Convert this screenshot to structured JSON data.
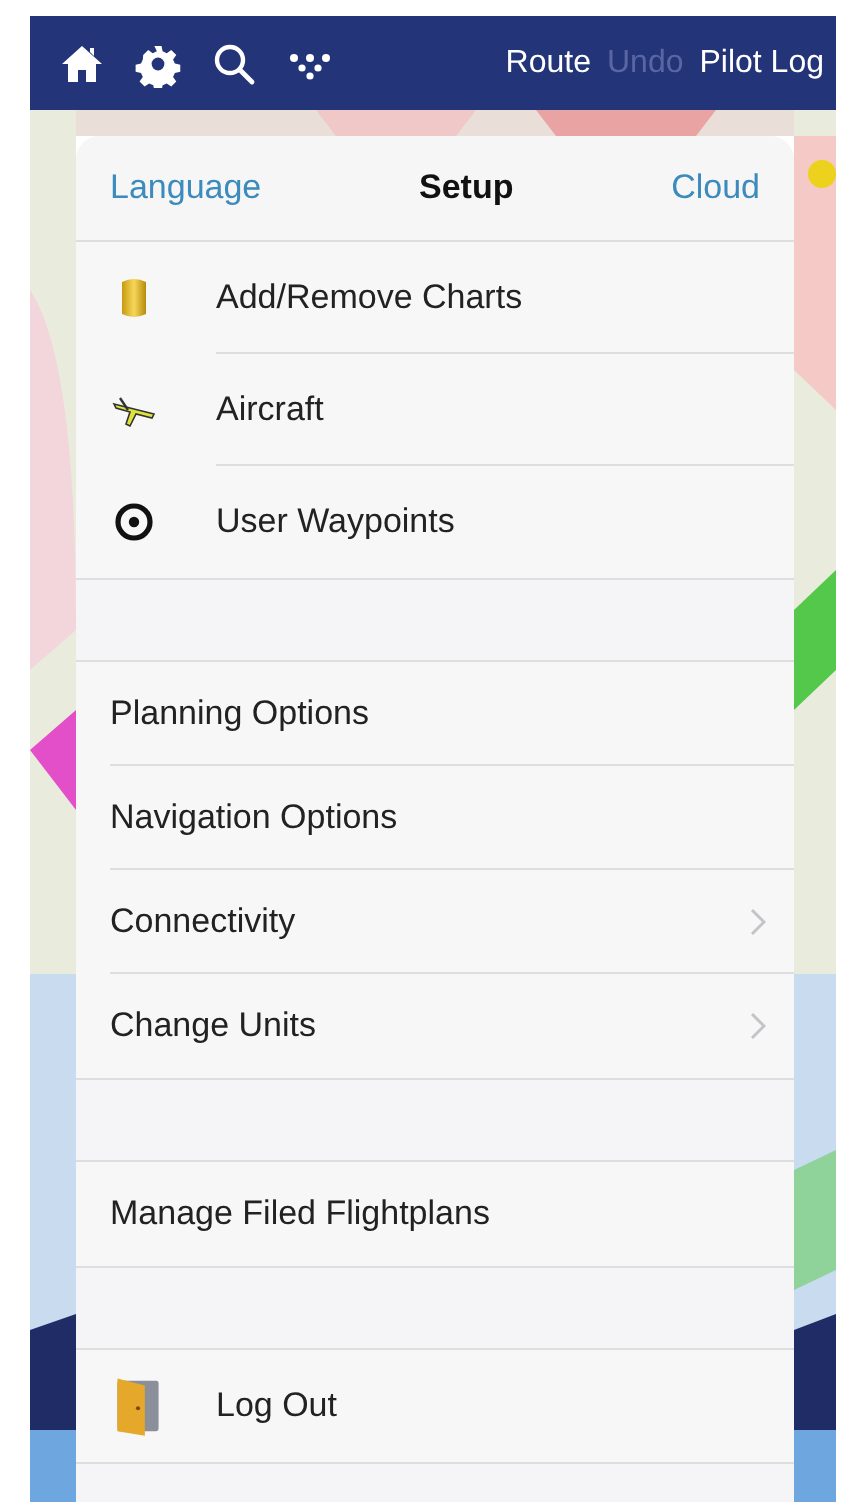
{
  "toolbar": {
    "icons": [
      {
        "kind": "home"
      },
      {
        "kind": "gear"
      },
      {
        "kind": "search"
      },
      {
        "kind": "dots"
      }
    ],
    "buttons": [
      {
        "label": "Route",
        "disabled": false
      },
      {
        "label": "Undo",
        "disabled": true
      },
      {
        "label": "Pilot Log",
        "disabled": false
      }
    ]
  },
  "setup": {
    "left_button": "Language",
    "title": "Setup",
    "right_button": "Cloud",
    "sections": [
      {
        "rows": [
          {
            "label": "Add/Remove Charts",
            "kind": "cylinder",
            "chevron": false
          },
          {
            "label": "Aircraft",
            "kind": "plane",
            "chevron": false
          },
          {
            "label": "User Waypoints",
            "kind": "target",
            "chevron": false
          }
        ]
      },
      {
        "rows": [
          {
            "label": "Planning Options",
            "kind": "plain",
            "chevron": false
          },
          {
            "label": "Navigation Options",
            "kind": "plain",
            "chevron": false
          },
          {
            "label": "Connectivity",
            "kind": "plain",
            "chevron": true
          },
          {
            "label": "Change Units",
            "kind": "plain",
            "chevron": true
          }
        ]
      },
      {
        "rows": [
          {
            "label": "Manage Filed Flightplans",
            "kind": "plain",
            "chevron": false
          }
        ]
      },
      {
        "rows": [
          {
            "label": "Log Out",
            "kind": "door",
            "chevron": false
          }
        ]
      }
    ]
  }
}
